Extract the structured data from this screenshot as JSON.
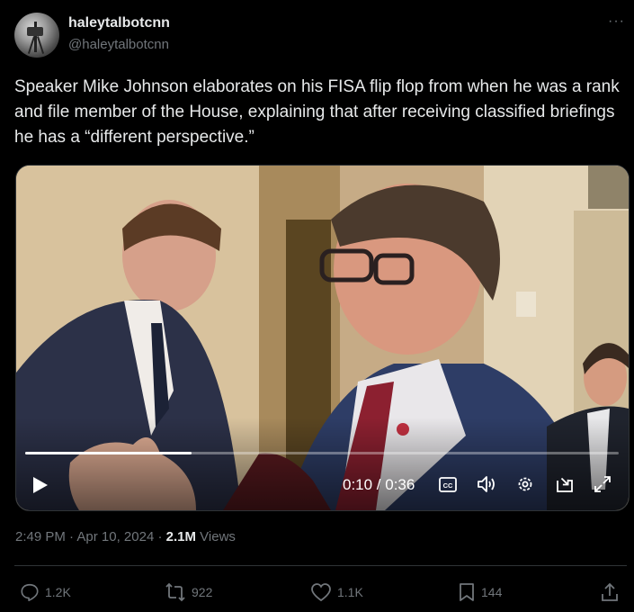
{
  "author": {
    "display_name": "haleytalbotcnn",
    "handle": "@haleytalbotcnn",
    "more_label": "···"
  },
  "tweet": {
    "text": "Speaker Mike Johnson elaborates on his FISA flip flop from when he was a rank and file member of the House, explaining that after receiving classified briefings he has a “different perspective.”"
  },
  "video": {
    "time_display": "0:10 / 0:36",
    "progress_fraction": 0.28,
    "controls": [
      "play-icon",
      "captions-icon",
      "volume-icon",
      "settings-icon",
      "pip-icon",
      "fullscreen-icon"
    ],
    "captions_label": "CC"
  },
  "meta": {
    "time": "2:49 PM",
    "separator": "·",
    "date": "Apr 10, 2024",
    "views_count": "2.1M",
    "views_label": "Views"
  },
  "actions": {
    "replies": "1.2K",
    "reposts": "922",
    "likes": "1.1K",
    "bookmarks": "144"
  },
  "colors": {
    "background": "#000000",
    "text_primary": "#e7e9ea",
    "text_secondary": "#71767b",
    "border": "#2f3336"
  }
}
